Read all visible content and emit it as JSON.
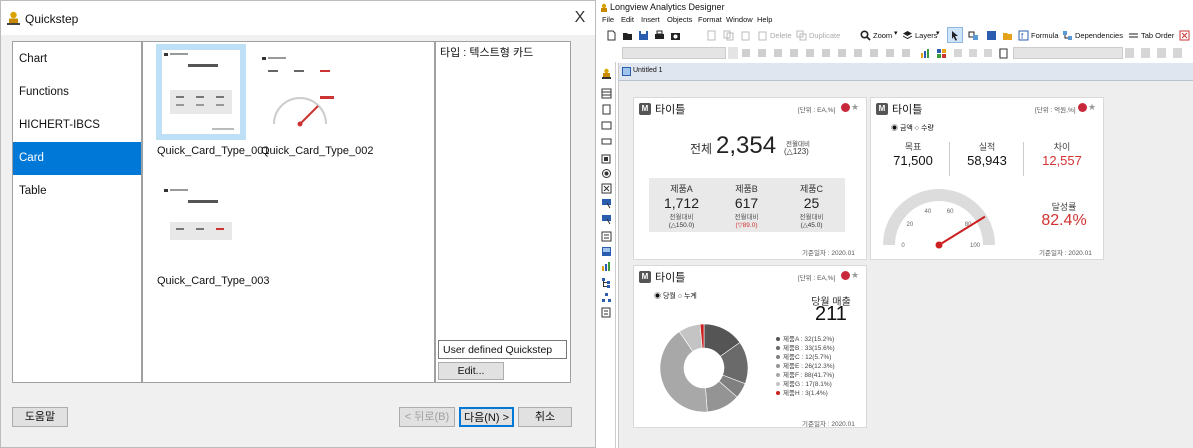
{
  "dialog": {
    "title": "Quickstep",
    "categories": [
      "Chart",
      "Functions",
      "HICHERT-IBCS",
      "Card",
      "Table"
    ],
    "thumbnails": [
      "Quick_Card_Type_001",
      "Quick_Card_Type_002",
      "Quick_Card_Type_003"
    ],
    "description": "타입 : 텍스트형 카드",
    "user_defined": "User defined Quickstep",
    "edit_label": "Edit...",
    "help_label": "도움말",
    "back_label": "< 뒤로(B)",
    "next_label": "다음(N) >",
    "cancel_label": "취소",
    "close_glyph": "X"
  },
  "app": {
    "title": "Longview Analytics Designer",
    "menu": [
      "File",
      "Edit",
      "Insert",
      "Objects",
      "Format",
      "Window",
      "Help"
    ],
    "toolbar": {
      "delete": "Delete",
      "duplicate": "Duplicate",
      "zoom": "Zoom",
      "layers": "Layers",
      "formula": "Formula",
      "dependencies": "Dependencies",
      "tab_order": "Tab Order"
    },
    "doc_tab": "Untitled 1"
  },
  "card1": {
    "badge": "M",
    "title": "타이틀",
    "unit": "[단위 : EA,%]",
    "total_label": "전체",
    "total_value": "2,354",
    "compare_label": "전월대비",
    "compare_value": "(△123)",
    "products": [
      {
        "name": "제품A",
        "value": "1,712",
        "label": "전월대비",
        "delta": "(△150.0)",
        "delta_color": "#333333"
      },
      {
        "name": "제품B",
        "value": "617",
        "label": "전월대비",
        "delta": "(▽89.0)",
        "delta_color": "#d23232"
      },
      {
        "name": "제품C",
        "value": "25",
        "label": "전월대비",
        "delta": "(△45.0)",
        "delta_color": "#333333"
      }
    ],
    "footer": "기준일자 : 2020.01"
  },
  "card2": {
    "badge": "M",
    "title": "타이틀",
    "unit": "[단위 : 억원,%]",
    "radio1": "금액",
    "radio2": "수량",
    "target_label": "목표",
    "target_value": "71,500",
    "actual_label": "실적",
    "actual_value": "58,943",
    "diff_label": "차이",
    "diff_value": "12,557",
    "diff_color": "#d23232",
    "rate_label": "달성률",
    "rate_value": "82.4%",
    "rate_color": "#d23232",
    "gauge_ticks": [
      "0",
      "20",
      "40",
      "60",
      "80",
      "100"
    ],
    "gauge_value": 82.4,
    "footer": "기준일자 : 2020.01"
  },
  "card3": {
    "badge": "M",
    "title": "타이틀",
    "unit": "[단위 : EA,%]",
    "radio1": "당월",
    "radio2": "누계",
    "sales_label": "당월 매출",
    "sales_value": "211",
    "legend": [
      {
        "text": "제품A : 32(15.2%)",
        "color": "#555555"
      },
      {
        "text": "제품B : 33(15.6%)",
        "color": "#6a6a6a"
      },
      {
        "text": "제품C : 12(5.7%)",
        "color": "#808080"
      },
      {
        "text": "제품E : 26(12.3%)",
        "color": "#949494"
      },
      {
        "text": "제품F : 88(41.7%)",
        "color": "#a8a8a8"
      },
      {
        "text": "제품G : 17(8.1%)",
        "color": "#c4c4c4"
      },
      {
        "text": "제품H : 3(1.4%)",
        "color": "#cc1f1f"
      }
    ],
    "footer": "기준일자 : 2020.01"
  }
}
